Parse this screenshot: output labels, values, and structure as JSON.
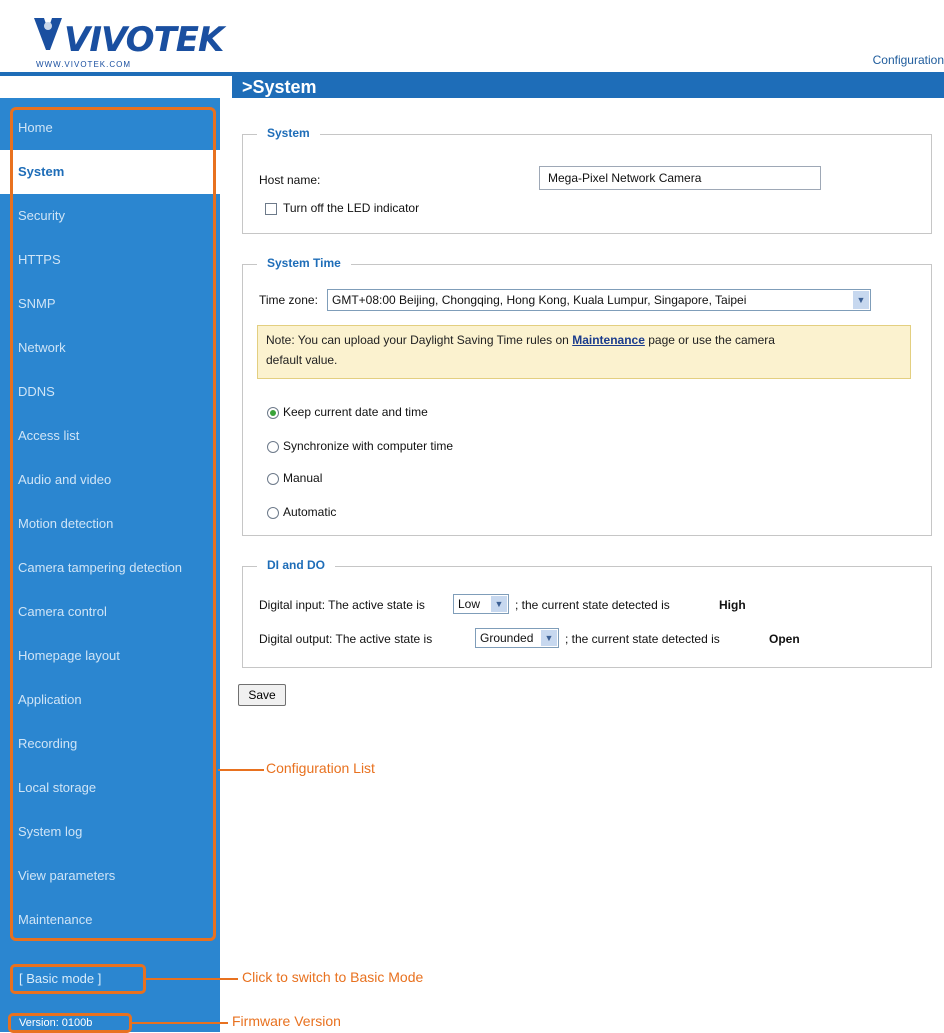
{
  "header": {
    "brand": "VIVOTEK",
    "brand_url": "WWW.VIVOTEK.COM",
    "config_link": "Configuration",
    "page_title": ">System"
  },
  "sidebar": {
    "items": [
      {
        "label": "Home"
      },
      {
        "label": "System"
      },
      {
        "label": "Security"
      },
      {
        "label": "HTTPS"
      },
      {
        "label": "SNMP"
      },
      {
        "label": "Network"
      },
      {
        "label": "DDNS"
      },
      {
        "label": "Access list"
      },
      {
        "label": "Audio and video"
      },
      {
        "label": "Motion detection"
      },
      {
        "label": "Camera tampering detection"
      },
      {
        "label": "Camera control"
      },
      {
        "label": "Homepage layout"
      },
      {
        "label": "Application"
      },
      {
        "label": "Recording"
      },
      {
        "label": "Local storage"
      },
      {
        "label": "System log"
      },
      {
        "label": "View parameters"
      },
      {
        "label": "Maintenance"
      }
    ],
    "active": "System",
    "basic_mode": "[ Basic mode ]",
    "version": "Version: 0100b"
  },
  "callouts": {
    "config_list": "Configuration List",
    "basic_mode": "Click to switch to Basic Mode",
    "firmware": "Firmware Version"
  },
  "system": {
    "legend": "System",
    "host_label": "Host name:",
    "host_value": "Mega-Pixel Network Camera",
    "led_label": "Turn off the LED indicator"
  },
  "system_time": {
    "legend": "System Time",
    "tz_label": "Time zone:",
    "tz_value": "GMT+08:00 Beijing, Chongqing, Hong Kong, Kuala Lumpur, Singapore, Taipei",
    "note_pre": "Note: You can upload your Daylight Saving Time rules on",
    "note_link": "Maintenance",
    "note_post": "page or use the camera",
    "note_line2": "default value.",
    "options": [
      {
        "label": "Keep current date and time"
      },
      {
        "label": "Synchronize with computer time"
      },
      {
        "label": "Manual"
      },
      {
        "label": "Automatic"
      }
    ],
    "selected_option": "Keep current date and time"
  },
  "dido": {
    "legend": "DI and DO",
    "di_pre": "Digital input: The active state is",
    "di_value": "Low",
    "di_post": "; the current state detected is",
    "di_state": "High",
    "do_pre": "Digital output: The active state is",
    "do_value": "Grounded",
    "do_post": "; the current state detected is",
    "do_state": "Open"
  },
  "save_label": "Save",
  "colors": {
    "accent_blue": "#1e6db8",
    "sidebar_blue": "#2b86d0",
    "callout_orange": "#e8711f",
    "note_yellow": "#fbf2cf"
  }
}
